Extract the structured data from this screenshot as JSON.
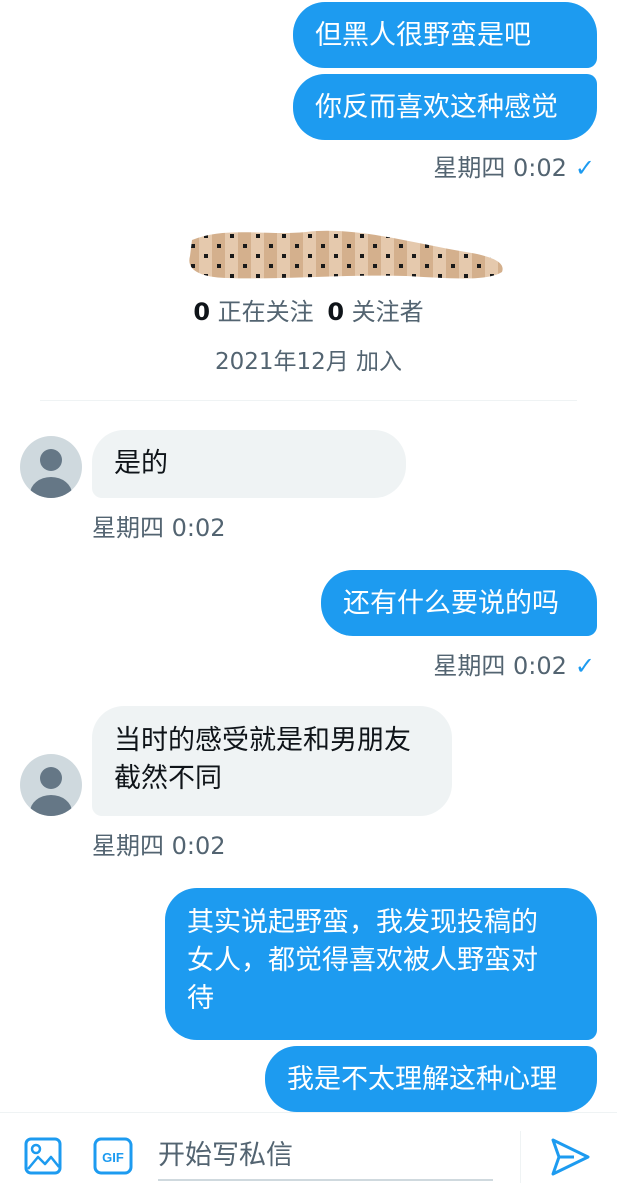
{
  "messages": {
    "m1": {
      "text": "但黑人很野蛮是吧"
    },
    "m2": {
      "text": "你反而喜欢这种感觉",
      "time": "星期四 0:02"
    },
    "m3": {
      "text": "是的",
      "time": "星期四 0:02"
    },
    "m4": {
      "text": "还有什么要说的吗",
      "time": "星期四 0:02"
    },
    "m5": {
      "line1": "当时的感受就是和男朋友",
      "line2": "截然不同",
      "time": "星期四 0:02"
    },
    "m6": {
      "line1": "其实说起野蛮，我发现投稿的",
      "line2": "女人，都觉得喜欢被人野蛮对",
      "line3": "待"
    },
    "m7": {
      "text": "我是不太理解这种心理"
    }
  },
  "read_check": "✓",
  "profile": {
    "following_count": "0",
    "following_label": "正在关注",
    "followers_count": "0",
    "followers_label": "关注者",
    "joined": "2021年12月 加入"
  },
  "composer": {
    "placeholder": "开始写私信",
    "gif_label": "GIF"
  },
  "colors": {
    "accent": "#1d9bf0",
    "incoming_bubble": "#eff3f4",
    "secondary_text": "#536471"
  },
  "icons": [
    "image-icon",
    "gif-icon",
    "send-icon",
    "avatar-placeholder-icon",
    "read-check-icon"
  ]
}
